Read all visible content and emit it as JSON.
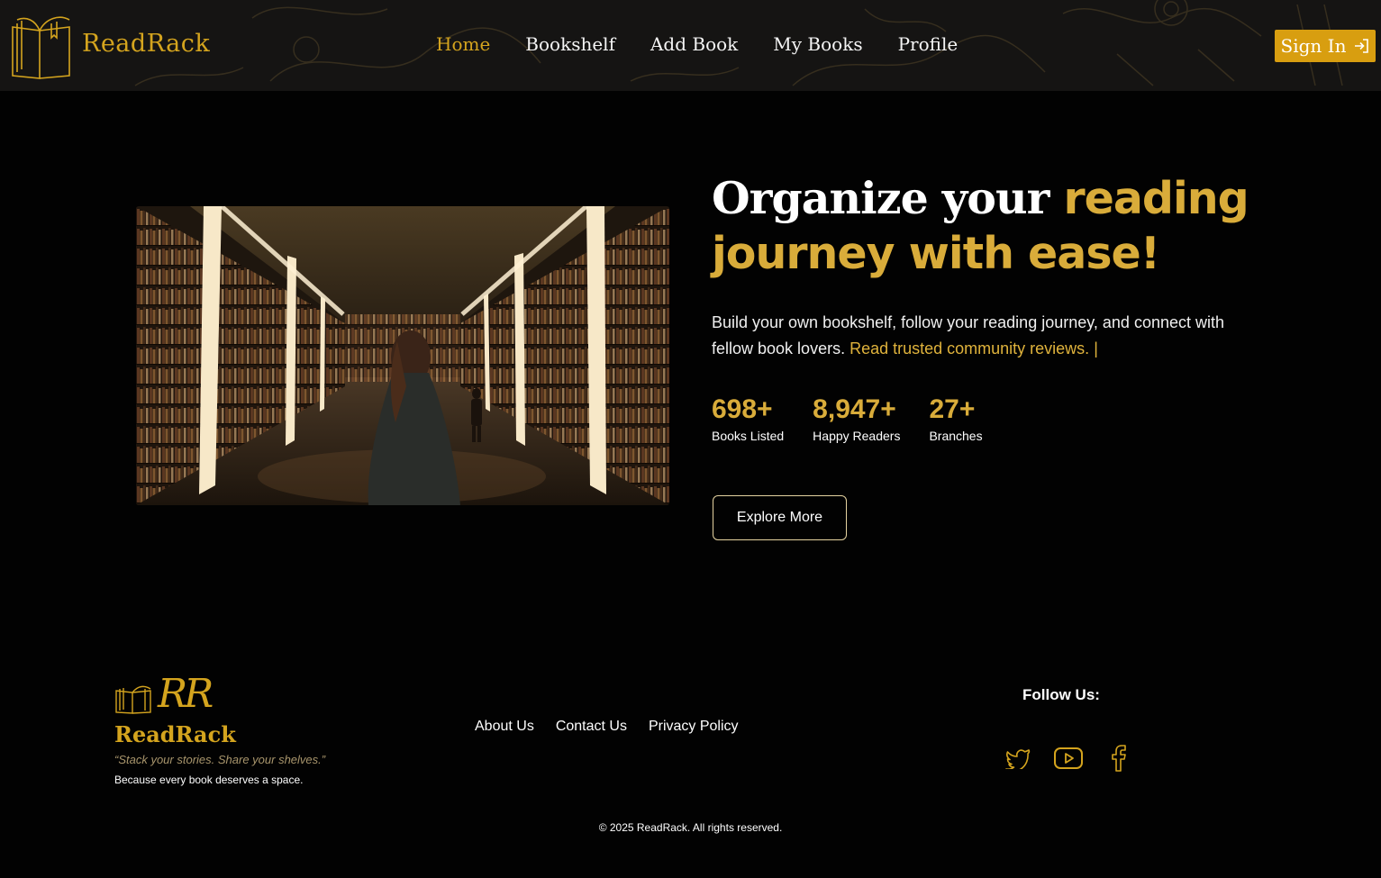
{
  "brand": {
    "name": "ReadRack"
  },
  "nav": {
    "items": [
      {
        "label": "Home",
        "active": true
      },
      {
        "label": "Bookshelf",
        "active": false
      },
      {
        "label": "Add Book",
        "active": false
      },
      {
        "label": "My Books",
        "active": false
      },
      {
        "label": "Profile",
        "active": false
      }
    ],
    "signin_label": "Sign In"
  },
  "hero": {
    "headline_white": "Organize your ",
    "headline_accent_1": "reading",
    "headline_accent_2": "journey with ease!",
    "lead_text": "Build your own bookshelf, follow your reading journey, and connect with fellow book lovers. ",
    "lead_highlight": "Read trusted community reviews.",
    "lead_cursor": "|",
    "stats": [
      {
        "value": "698+",
        "label": "Books Listed"
      },
      {
        "value": "8,947+",
        "label": "Happy Readers"
      },
      {
        "value": "27+",
        "label": "Branches"
      }
    ],
    "cta_label": "Explore More"
  },
  "footer": {
    "monogram": "RR",
    "brand_name": "ReadRack",
    "tagline": "“Stack your stories. Share your shelves.”",
    "subtext": "Because every book deserves a space.",
    "links": [
      "About Us",
      "Contact Us",
      "Privacy Policy"
    ],
    "follow_title": "Follow Us:",
    "socials": [
      "twitter-icon",
      "youtube-icon",
      "facebook-icon"
    ],
    "copyright": "© 2025 ReadRack. All rights reserved."
  },
  "colors": {
    "accent": "#d4a41e",
    "accent_text": "#d9ac3a",
    "signin_bg": "#d89e10",
    "background": "#020202",
    "nav_bg": "#141312"
  }
}
